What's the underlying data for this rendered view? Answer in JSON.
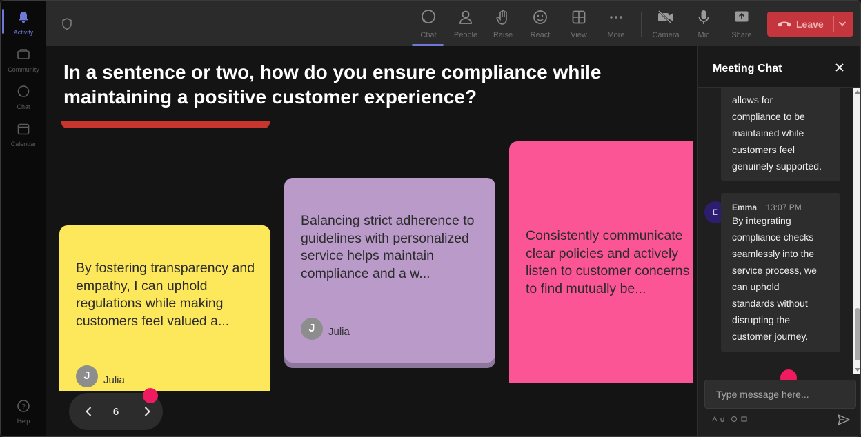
{
  "rail": {
    "items": [
      {
        "label": "Activity",
        "icon": "bell-icon",
        "active": true
      },
      {
        "label": "Community",
        "icon": "community-icon",
        "active": false
      },
      {
        "label": "Chat",
        "icon": "chat-icon",
        "active": false
      },
      {
        "label": "Calendar",
        "icon": "calendar-icon",
        "active": false
      }
    ],
    "help_label": "Help"
  },
  "toolbar": {
    "buttons": [
      {
        "label": "Chat",
        "icon": "chat-icon",
        "active": true
      },
      {
        "label": "People",
        "icon": "people-icon"
      },
      {
        "label": "Raise",
        "icon": "hand-icon"
      },
      {
        "label": "React",
        "icon": "smiley-icon"
      },
      {
        "label": "View",
        "icon": "grid-icon"
      },
      {
        "label": "More",
        "icon": "more-icon"
      },
      {
        "label": "Camera",
        "icon": "camera-off-icon"
      },
      {
        "label": "Mic",
        "icon": "mic-icon"
      },
      {
        "label": "Share",
        "icon": "share-icon"
      }
    ],
    "leave_label": "Leave",
    "leave_color": "#c4353d"
  },
  "stage": {
    "question": "In a sentence or two, how do you ensure compliance while maintaining a positive customer experience?",
    "cards": [
      {
        "text": "By fostering transparency and empathy, I can uphold regulations while making customers feel valued a...",
        "author": "Julia",
        "initial": "J",
        "color": "#fde75a"
      },
      {
        "text": "Balancing strict adherence to guidelines with personalized service helps maintain compliance and a w...",
        "author": "Julia",
        "initial": "J",
        "color": "#b99ac9"
      },
      {
        "text": "Consistently communicate clear policies and actively listen to customer concerns to find mutually be...",
        "color": "#fb5595"
      }
    ],
    "page_number": "6",
    "accent_color": "#ef1a60"
  },
  "chat": {
    "title": "Meeting Chat",
    "messages": [
      {
        "text_lines": [
          "allows for",
          "compliance to be",
          "maintained while",
          "customers feel",
          "genuinely supported."
        ]
      },
      {
        "author": "Emma",
        "initial": "E",
        "time": "13:07 PM",
        "text_lines": [
          "By integrating",
          "compliance checks",
          "seamlessly into the",
          "service process, we",
          "can uphold",
          "standards without",
          "disrupting the",
          "customer journey."
        ]
      }
    ],
    "input_placeholder": "Type message here..."
  }
}
